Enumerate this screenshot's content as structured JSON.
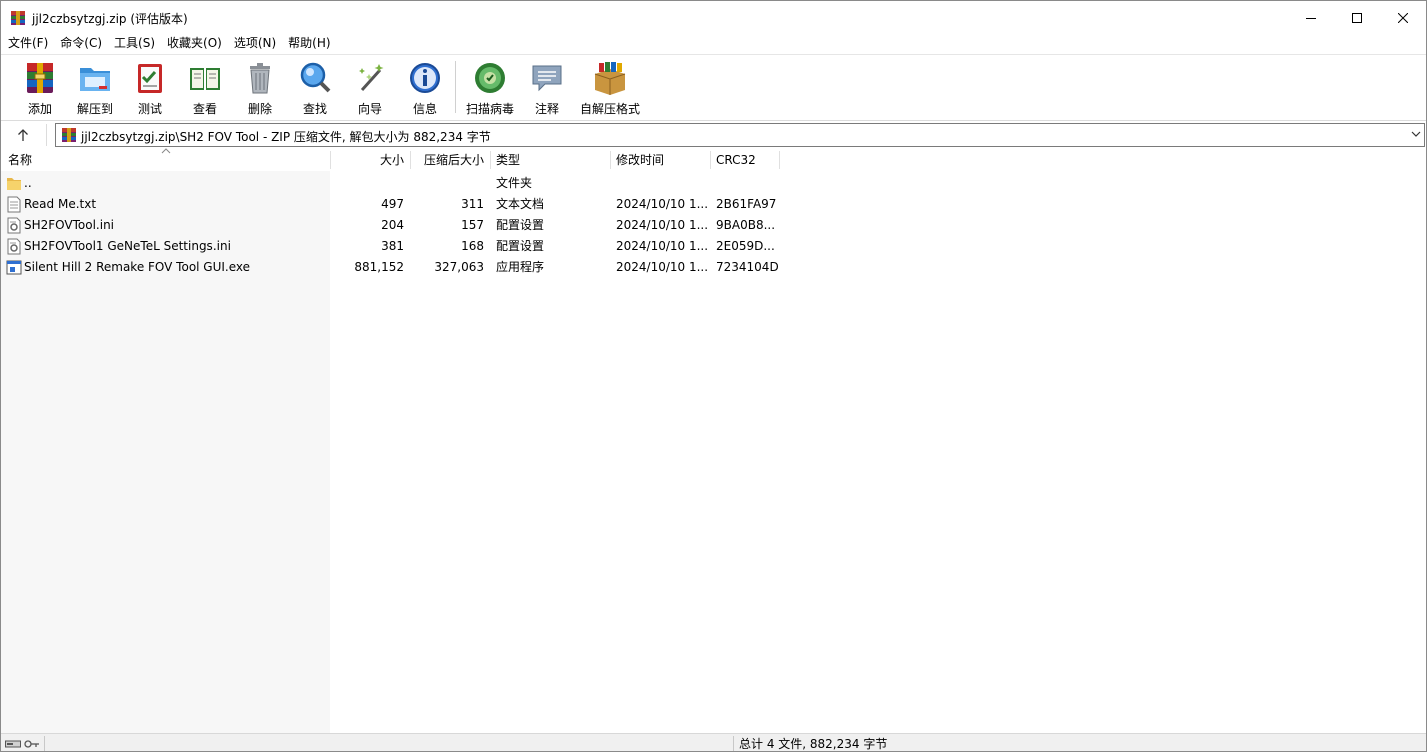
{
  "window": {
    "title": "jjl2czbsytzgj.zip (评估版本)",
    "icon": "winrar-archive-icon"
  },
  "menu": [
    {
      "label": "文件(F)"
    },
    {
      "label": "命令(C)"
    },
    {
      "label": "工具(S)"
    },
    {
      "label": "收藏夹(O)"
    },
    {
      "label": "选项(N)"
    },
    {
      "label": "帮助(H)"
    }
  ],
  "toolbar": {
    "add": "添加",
    "extract": "解压到",
    "test": "测试",
    "view": "查看",
    "delete": "删除",
    "find": "查找",
    "wizard": "向导",
    "info": "信息",
    "scan": "扫描病毒",
    "comment": "注释",
    "sfx": "自解压格式"
  },
  "address": {
    "path": "jjl2czbsytzgj.zip\\SH2 FOV Tool - ZIP 压缩文件, 解包大小为 882,234 字节"
  },
  "columns": {
    "name": "名称",
    "size": "大小",
    "packed": "压缩后大小",
    "type": "类型",
    "modified": "修改时间",
    "crc": "CRC32"
  },
  "files": [
    {
      "name": "..",
      "size": "",
      "packed": "",
      "type": "文件夹",
      "modified": "",
      "crc": "",
      "icon": "folder-icon"
    },
    {
      "name": "Read Me.txt",
      "size": "497",
      "packed": "311",
      "type": "文本文档",
      "modified": "2024/10/10 1...",
      "crc": "2B61FA97",
      "icon": "text-file-icon"
    },
    {
      "name": "SH2FOVTool.ini",
      "size": "204",
      "packed": "157",
      "type": "配置设置",
      "modified": "2024/10/10 1...",
      "crc": "9BA0B8...",
      "icon": "settings-file-icon"
    },
    {
      "name": "SH2FOVTool1 GeNeTeL Settings.ini",
      "size": "381",
      "packed": "168",
      "type": "配置设置",
      "modified": "2024/10/10 1...",
      "crc": "2E059D...",
      "icon": "settings-file-icon"
    },
    {
      "name": "Silent Hill 2 Remake FOV Tool GUI.exe",
      "size": "881,152",
      "packed": "327,063",
      "type": "应用程序",
      "modified": "2024/10/10 1...",
      "crc": "7234104D",
      "icon": "exe-file-icon"
    }
  ],
  "status": {
    "summary": "总计 4 文件, 882,234 字节"
  }
}
